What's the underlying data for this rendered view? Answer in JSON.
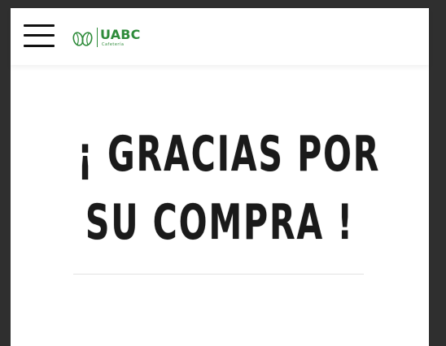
{
  "header": {
    "menu_icon": "hamburger-menu-icon",
    "logo": {
      "icon": "coffee-beans-icon",
      "text": "UABC",
      "subtext": "Cafetería",
      "color": "#2e8b3a"
    }
  },
  "main": {
    "thanks_line1": "¡ GRACIAS POR",
    "thanks_line2": "SU COMPRA !"
  }
}
